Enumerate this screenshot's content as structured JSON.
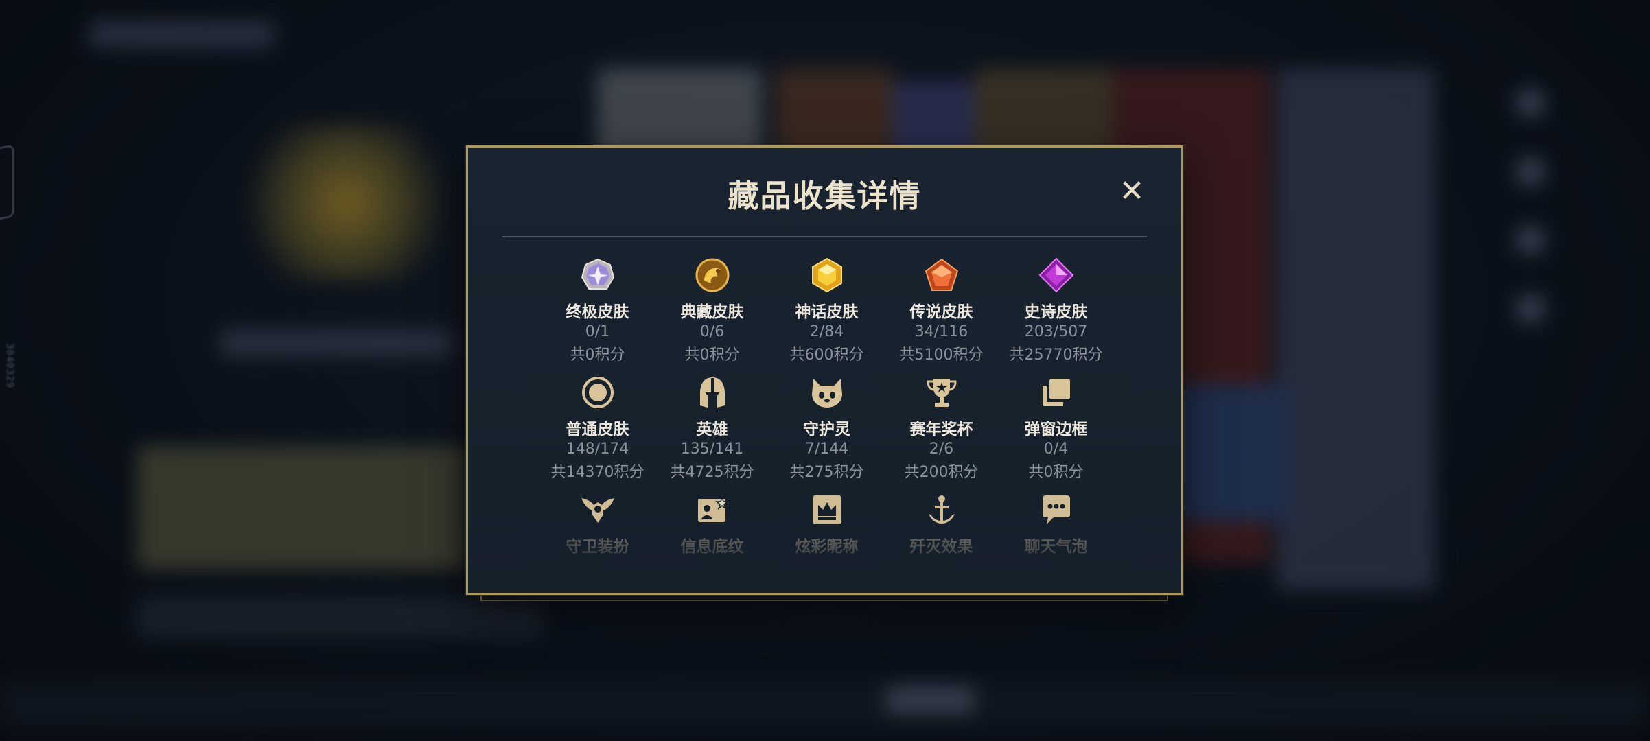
{
  "side_text": "3040329",
  "modal": {
    "title": "藏品收集详情",
    "close_label": "✕",
    "rows": [
      [
        {
          "icon": "ultimate-skin-icon",
          "label": "终极皮肤",
          "count": "0/1",
          "points": "共0积分"
        },
        {
          "icon": "classic-skin-icon",
          "label": "典藏皮肤",
          "count": "0/6",
          "points": "共0积分"
        },
        {
          "icon": "myth-skin-icon",
          "label": "神话皮肤",
          "count": "2/84",
          "points": "共600积分"
        },
        {
          "icon": "legend-skin-icon",
          "label": "传说皮肤",
          "count": "34/116",
          "points": "共5100积分"
        },
        {
          "icon": "epic-skin-icon",
          "label": "史诗皮肤",
          "count": "203/507",
          "points": "共25770积分"
        }
      ],
      [
        {
          "icon": "normal-skin-icon",
          "label": "普通皮肤",
          "count": "148/174",
          "points": "共14370积分"
        },
        {
          "icon": "hero-helmet-icon",
          "label": "英雄",
          "count": "135/141",
          "points": "共4725积分"
        },
        {
          "icon": "guardian-spirit-icon",
          "label": "守护灵",
          "count": "7/144",
          "points": "共275积分"
        },
        {
          "icon": "trophy-icon",
          "label": "赛年奖杯",
          "count": "2/6",
          "points": "共200积分"
        },
        {
          "icon": "popup-frame-icon",
          "label": "弹窗边框",
          "count": "0/4",
          "points": "共0积分"
        }
      ],
      [
        {
          "icon": "guardian-outfit-icon",
          "label": "守卫装扮"
        },
        {
          "icon": "info-pattern-icon",
          "label": "信息底纹"
        },
        {
          "icon": "nickname-crown-icon",
          "label": "炫彩昵称"
        },
        {
          "icon": "kill-effect-icon",
          "label": "歼灭效果"
        },
        {
          "icon": "chat-bubble-icon",
          "label": "聊天气泡"
        }
      ]
    ]
  },
  "colors": {
    "modal_border": "#b0985c",
    "title_text": "#ece3cd",
    "icon_gold": "#d9c49a"
  }
}
